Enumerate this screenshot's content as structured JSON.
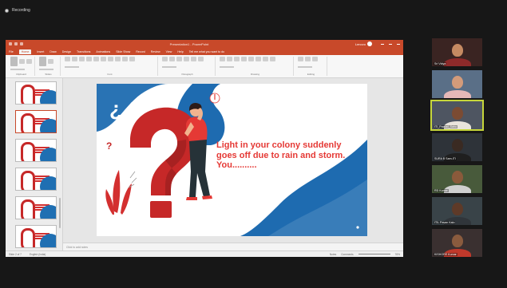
{
  "recording": {
    "label": "Recording"
  },
  "ppt": {
    "title": "Presentation1 - PowerPoint",
    "account": "Lenovo",
    "tabs": [
      "File",
      "Home",
      "Insert",
      "Draw",
      "Design",
      "Transitions",
      "Animations",
      "Slide Show",
      "Record",
      "Review",
      "View",
      "Help"
    ],
    "active_tab": "Home",
    "tell_me": "Tell me what you want to do",
    "ribbon_groups": [
      "Clipboard",
      "Slides",
      "Font",
      "Paragraph",
      "Drawing",
      "Editing"
    ],
    "slide_count": 7,
    "active_slide_index": 1,
    "notes_placeholder": "Click to add notes",
    "status": {
      "slide": "Slide 2 of 7",
      "language": "English (India)",
      "notes": "Notes",
      "comments": "Comments",
      "zoom": "76%"
    }
  },
  "slide": {
    "headline": "Light in your colony suddenly goes off due to rain and storm. You..........",
    "colors": {
      "red": "#e53935",
      "dark_red": "#b71c1c",
      "blue": "#1e6bb0",
      "skin": "#f2b38e"
    }
  },
  "participants": [
    {
      "name": "Sri Vidya",
      "bg": "#3a2422",
      "skin": "#c58a62",
      "shirt": "#8e2a2a",
      "active": false
    },
    {
      "name": "",
      "bg": "#5a6f87",
      "skin": "#d39b7a",
      "shirt": "#e6b8b8",
      "active": false
    },
    {
      "name": "ITI_Prasad_Sahu",
      "bg": "#4e5561",
      "skin": "#7b4b33",
      "shirt": "#e9e4dc",
      "active": true
    },
    {
      "name": "SURA B Sam-ITI",
      "bg": "#2e3339",
      "skin": "#3a2a22",
      "shirt": "#1f1f1f",
      "active": false
    },
    {
      "name": "RD Kumar",
      "bg": "#485a3b",
      "skin": "#8a5a3b",
      "shirt": "#d0d0d0",
      "active": false
    },
    {
      "name": "ITIL Pavan Kalo",
      "bg": "#394348",
      "skin": "#5e3a28",
      "shirt": "#30353a",
      "active": false
    },
    {
      "name": "KISHORE Kumar",
      "bg": "#3a3030",
      "skin": "#8a5b3e",
      "shirt": "#c0392b",
      "active": false
    }
  ]
}
